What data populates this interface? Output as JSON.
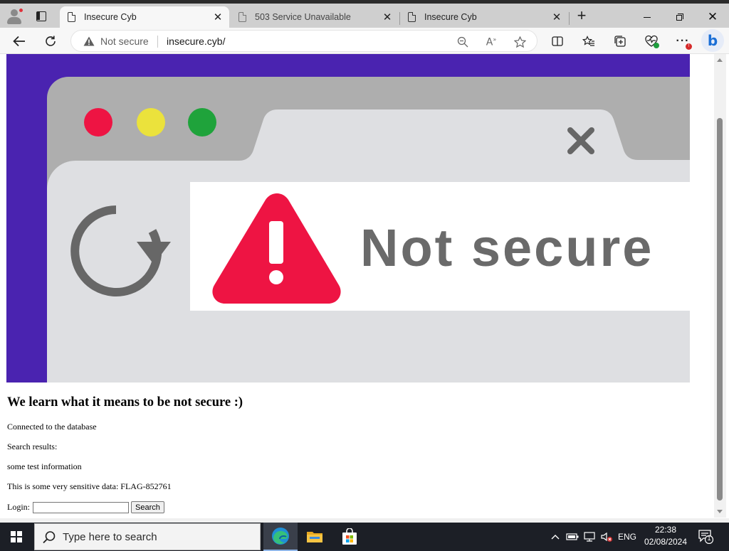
{
  "browser": {
    "tabs": [
      {
        "title": "Insecure Cyb",
        "active": true
      },
      {
        "title": "503 Service Unavailable",
        "active": false
      },
      {
        "title": "Insecure Cyb",
        "active": false
      }
    ],
    "address": {
      "security_label": "Not secure",
      "url": "insecure.cyb/"
    }
  },
  "page": {
    "hero_image": {
      "text": "Not secure",
      "colors": {
        "frame": "#4a23b0",
        "window": "#dedfe2",
        "chrome": "#aeaeae",
        "alert": "#ee1443",
        "text": "#6a6a6a"
      }
    },
    "heading": "We learn what it means to be not secure :)",
    "lines": [
      "Connected to the database",
      "Search results:",
      "some test information",
      "This is some very sensitive data: FLAG-852761"
    ],
    "login_label": "Login:",
    "login_value": "",
    "search_button": "Search"
  },
  "taskbar": {
    "search_placeholder": "Type here to search",
    "language": "ENG",
    "time": "22:38",
    "date": "02/08/2024",
    "notification_count": "1"
  }
}
